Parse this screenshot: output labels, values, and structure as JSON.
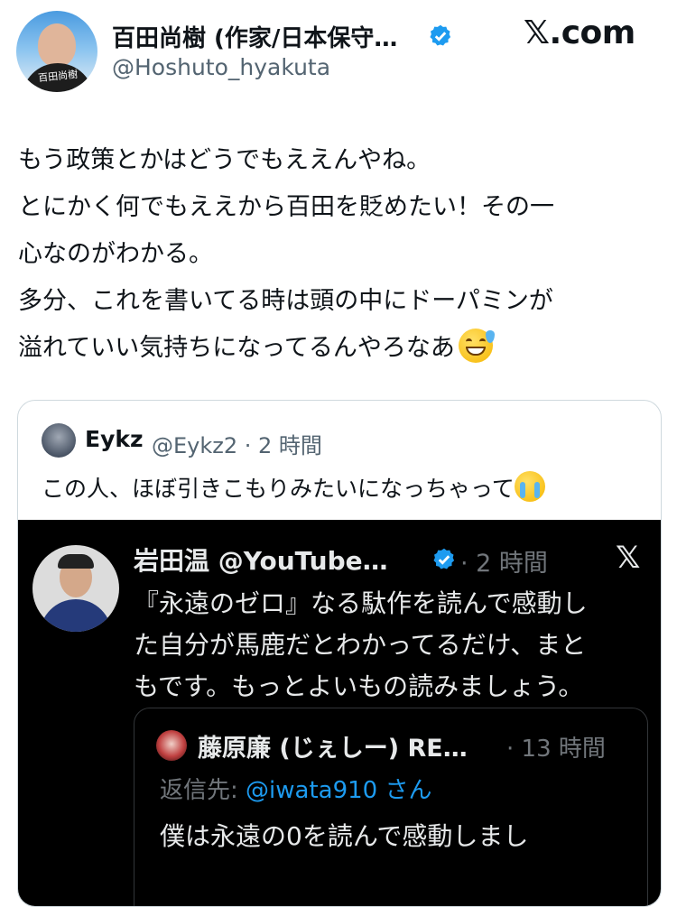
{
  "header": {
    "author_name": "百田尚樹 (作家/日本保守…",
    "author_handle": "@Hoshuto_hyakuta",
    "brand": ".com",
    "avatar_signature": "百田尚樹"
  },
  "tweet": {
    "lines": [
      "もう政策とかはどうでもええんやね。",
      "とにかく何でもええから百田を貶めたい！その一",
      "心なのがわかる。",
      "多分、これを書いてる時は頭の中にドーパミンが",
      "溢れていい気持ちになってるんやろなあ"
    ],
    "emoji": "grinning-face-with-sweat"
  },
  "quote": {
    "name": "Eykz",
    "meta": "@Eykz2 · 2 時間",
    "text": "この人、ほぼ引きこもりみたいになっちゃって",
    "emoji": "loudly-crying-face"
  },
  "screenshot": {
    "name": "岩田温 @YouTube…",
    "time": "· 2 時間",
    "x_mark": "𝕏",
    "lines": [
      "『永遠のゼロ』なる駄作を読んで感動し",
      "た自分が馬鹿だとわかってるだけ、まと",
      "もです。もっとよいもの読みましょう。"
    ],
    "inner": {
      "name": "藤原廉 (じぇしー) RE…",
      "time": "· 13 時間",
      "reply_prefix": "返信先: ",
      "reply_mention": "@iwata910 さん",
      "text": "僕は永遠の0を読んで感動しまし"
    }
  },
  "colors": {
    "verified": "#1d9bf0",
    "secondary_text": "#536471",
    "dark_bg": "#000000"
  }
}
